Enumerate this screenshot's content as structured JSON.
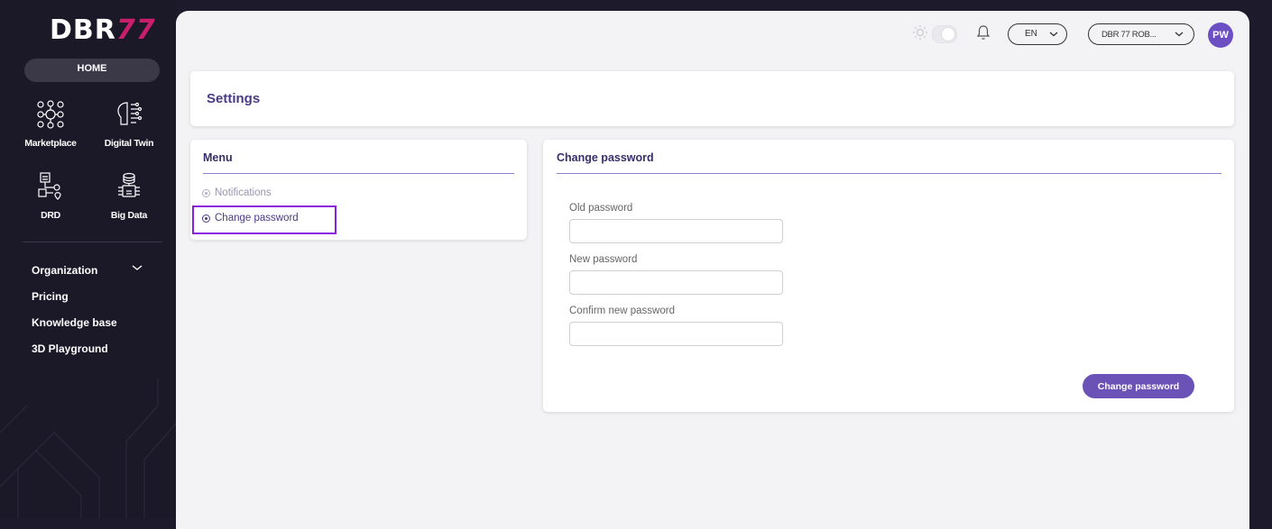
{
  "brand": {
    "logo_main": "DBR",
    "logo_accent": "77"
  },
  "sidebar": {
    "home_label": "HOME",
    "apps": [
      {
        "label": "Marketplace",
        "icon": "marketplace-icon"
      },
      {
        "label": "Digital Twin",
        "icon": "digital-twin-icon"
      },
      {
        "label": "DRD",
        "icon": "drd-icon"
      },
      {
        "label": "Big Data",
        "icon": "big-data-icon"
      }
    ],
    "nav": [
      {
        "label": "Organization",
        "has_dropdown": true
      },
      {
        "label": "Pricing"
      },
      {
        "label": "Knowledge base"
      },
      {
        "label": "3D Playground"
      }
    ]
  },
  "topbar": {
    "language": "EN",
    "organization": "DBR 77 ROB...",
    "avatar_initials": "PW",
    "theme_toggle": "light"
  },
  "settings": {
    "title": "Settings"
  },
  "menu": {
    "title": "Menu",
    "items": [
      {
        "label": "Notifications",
        "active": false
      },
      {
        "label": "Change password",
        "active": true
      }
    ]
  },
  "change_password": {
    "title": "Change password",
    "fields": [
      {
        "label": "Old password",
        "value": ""
      },
      {
        "label": "New password",
        "value": ""
      },
      {
        "label": "Confirm new password",
        "value": ""
      }
    ],
    "submit_label": "Change password"
  },
  "colors": {
    "sidebar_bg": "#1b1828",
    "accent": "#6a52b7",
    "brand_pink": "#c81e6c",
    "highlight_border": "#8a1fe0"
  }
}
